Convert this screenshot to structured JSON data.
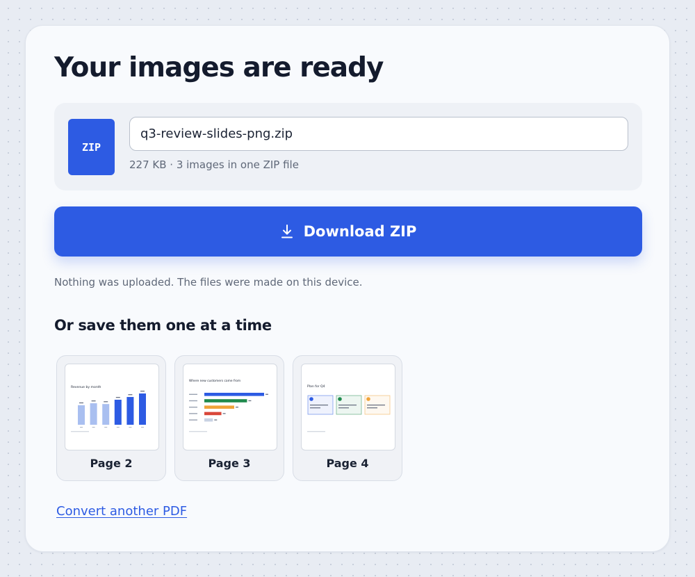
{
  "title": "Your images are ready",
  "file": {
    "icon_label": "ZIP",
    "name": "q3-review-slides-png.zip",
    "meta": "227  KB · 3 images in one ZIP file"
  },
  "download": {
    "label": "Download ZIP",
    "icon": "download-icon"
  },
  "privacy_note": "Nothing was uploaded. The files were made on this device.",
  "individual_heading": "Or save them one at a time",
  "pages": [
    {
      "label": "Page 2",
      "thumb_title": "Revenue by month",
      "bars": [
        {
          "value": 5.0,
          "color": "#a9bff0"
        },
        {
          "value": 5.5,
          "color": "#a9bff0"
        },
        {
          "value": 5.3,
          "color": "#a9bff0"
        },
        {
          "value": 6.4,
          "color": "#2d5be3"
        },
        {
          "value": 7.1,
          "color": "#2d5be3"
        },
        {
          "value": 8.0,
          "color": "#2d5be3"
        }
      ]
    },
    {
      "label": "Page 3",
      "thumb_title": "Where new customers came from",
      "hbars": [
        {
          "value": 42,
          "color": "#2d5be3"
        },
        {
          "value": 30,
          "color": "#1f8a4c"
        },
        {
          "value": 21,
          "color": "#f0a33a"
        },
        {
          "value": 12,
          "color": "#d9473a"
        },
        {
          "value": 6,
          "color": "#c9d2e3"
        }
      ]
    },
    {
      "label": "Page 4",
      "thumb_title": "Plan for Q4",
      "cards": [
        {
          "color": "#2d5be3"
        },
        {
          "color": "#1f8a4c"
        },
        {
          "color": "#f0a33a"
        }
      ]
    }
  ],
  "convert_link": "Convert another PDF",
  "colors": {
    "accent": "#2d5be3",
    "text": "#141b2d",
    "muted": "#5f6878",
    "background": "#e8ecf3",
    "card": "#f8fafd"
  }
}
